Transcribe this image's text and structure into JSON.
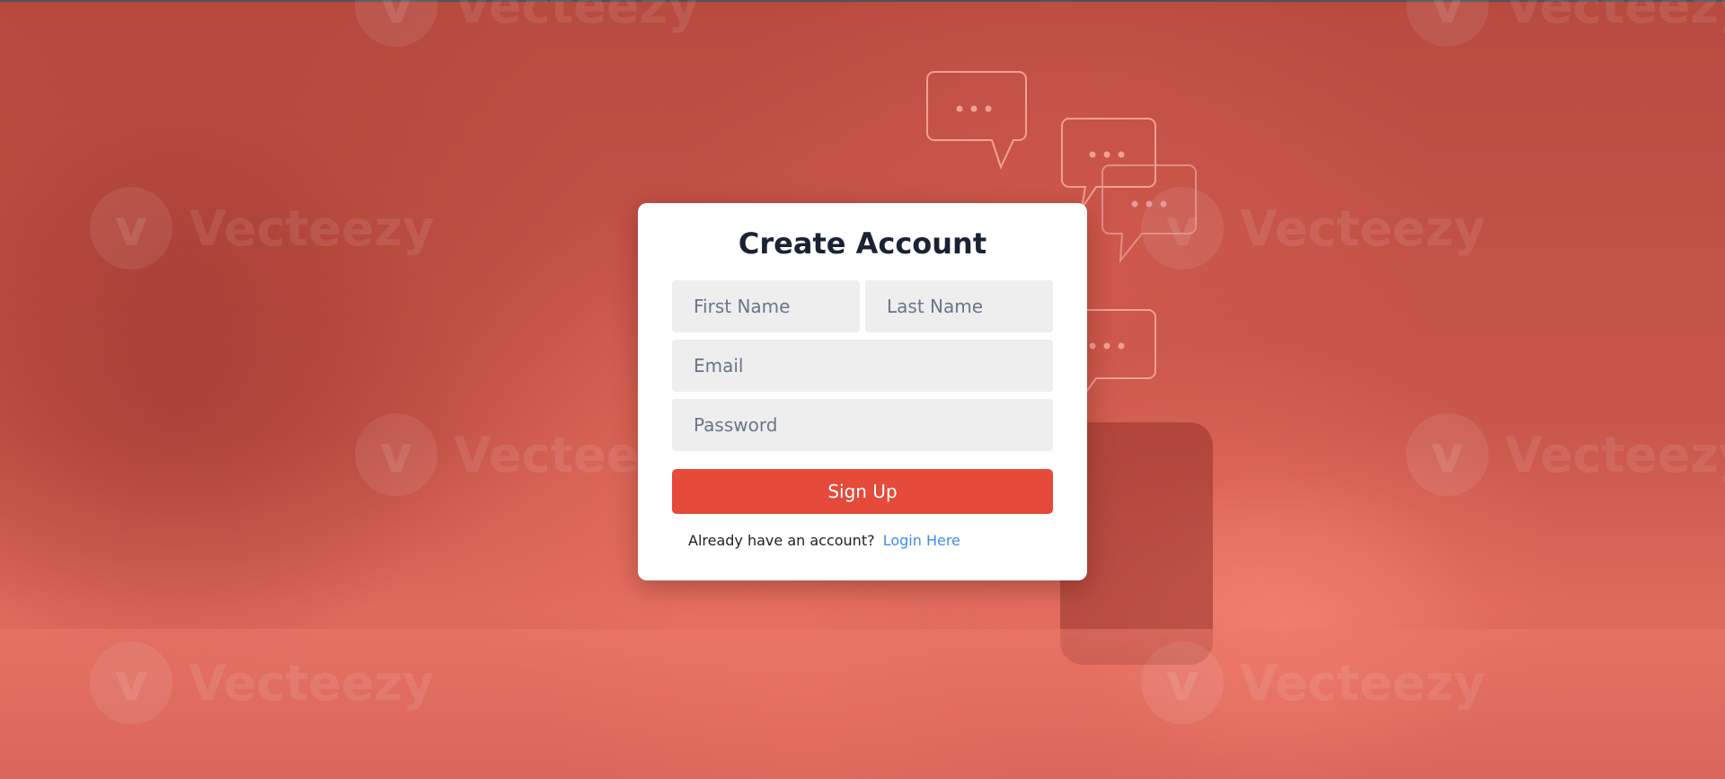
{
  "form": {
    "title": "Create Account",
    "first_name_placeholder": "First Name",
    "last_name_placeholder": "Last Name",
    "email_placeholder": "Email",
    "password_placeholder": "Password",
    "submit_label": "Sign Up",
    "footer_text": "Already have an account?",
    "login_link": "Login Here"
  },
  "background": {
    "watermark_text": "Vecteezy",
    "watermark_glyph": "v"
  },
  "colors": {
    "background_tint": "#c9574a",
    "card": "#ffffff",
    "title": "#1a2233",
    "input_bg": "#eeeeee",
    "placeholder": "#6b7488",
    "button": "#e64a3b",
    "link": "#3d8ee8"
  }
}
